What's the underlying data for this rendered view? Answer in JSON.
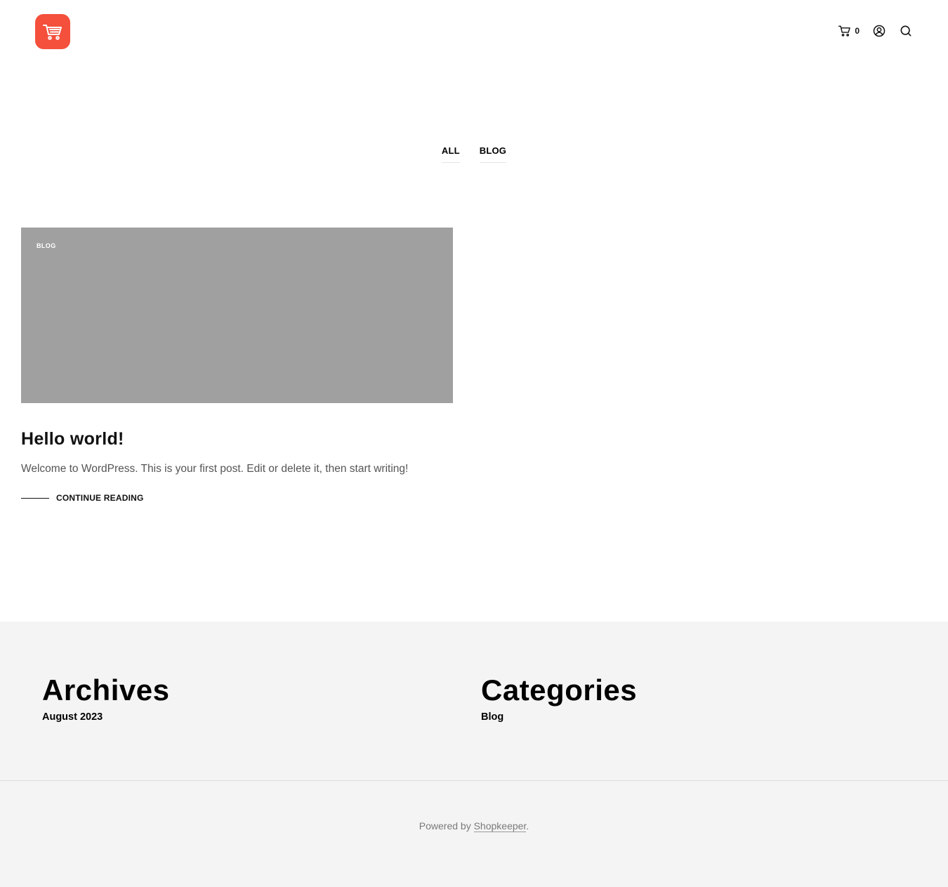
{
  "header": {
    "logo_icon": "shopping-cart-logo",
    "brand_color": "#f4503c",
    "cart_icon": "cart-icon",
    "cart_count": "0",
    "account_icon": "user-icon",
    "search_icon": "search-icon"
  },
  "filters": [
    {
      "label": "ALL"
    },
    {
      "label": "BLOG"
    }
  ],
  "post": {
    "category": "BLOG",
    "image_color": "#a0a0a0",
    "title": "Hello world!",
    "excerpt": "Welcome to WordPress. This is your first post. Edit or delete it, then start writing!",
    "continue_label": "CONTINUE READING"
  },
  "widgets": {
    "archives": {
      "title": "Archives",
      "items": [
        "August 2023"
      ]
    },
    "categories": {
      "title": "Categories",
      "items": [
        "Blog"
      ]
    }
  },
  "footer": {
    "credit_prefix": "Powered by ",
    "credit_link": "Shopkeeper",
    "credit_suffix": "."
  }
}
